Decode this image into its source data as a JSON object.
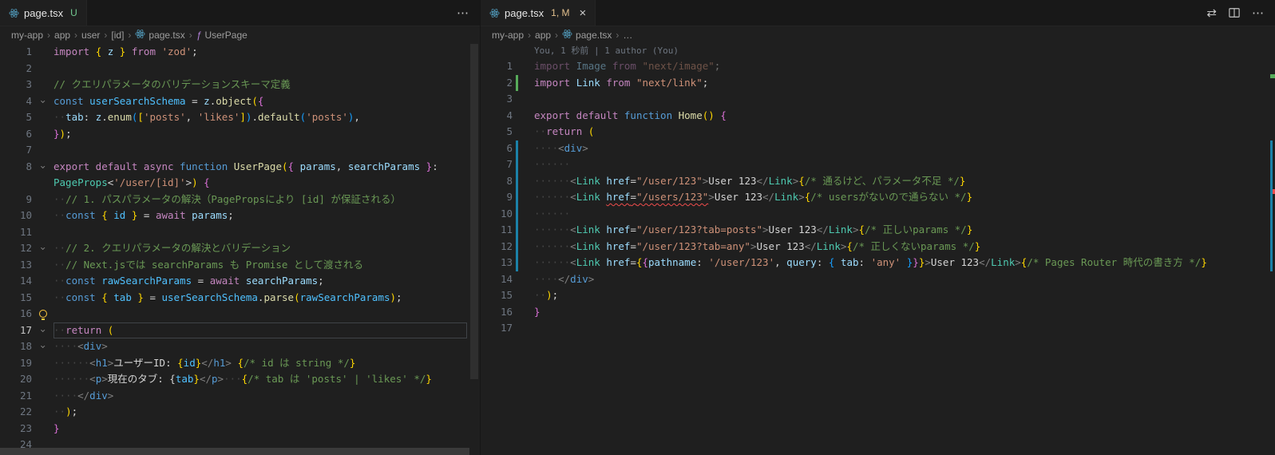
{
  "colors": {
    "editor_bg": "#1f1f1f",
    "tabbar_bg": "#181818",
    "untracked_badge": "#73C991",
    "modified_badge": "#E2C08D",
    "git_added": "#57ab5a",
    "git_modified": "#1B81A8",
    "error": "#F14C4C"
  },
  "left_pane": {
    "tab": {
      "icon": "react",
      "label": "page.tsx",
      "badge": "U"
    },
    "actions": {
      "more": "⋯"
    },
    "breadcrumbs": [
      {
        "label": "my-app"
      },
      {
        "label": "app"
      },
      {
        "label": "user"
      },
      {
        "label": "[id]"
      },
      {
        "label": "page.tsx",
        "icon": "react"
      },
      {
        "label": "UserPage",
        "icon": "symbol-function"
      }
    ],
    "rows": [
      {
        "n": 1,
        "t": [
          [
            "kw",
            "import "
          ],
          [
            "b1",
            "{ "
          ],
          [
            "var",
            "z"
          ],
          [
            "b1",
            " }"
          ],
          [
            "kw",
            " from "
          ],
          [
            "str",
            "'zod'"
          ],
          [
            "pn",
            ";"
          ]
        ]
      },
      {
        "n": 2
      },
      {
        "n": 3,
        "t": [
          [
            "cm",
            "// クエリパラメータのバリデーションスキーマ定義"
          ]
        ]
      },
      {
        "n": 4,
        "fold": true,
        "t": [
          [
            "kw2",
            "const "
          ],
          [
            "cvar",
            "userSearchSchema"
          ],
          [
            "pn",
            " = "
          ],
          [
            "var",
            "z"
          ],
          [
            "pn",
            "."
          ],
          [
            "fn",
            "object"
          ],
          [
            "b1",
            "("
          ],
          [
            "b2",
            "{"
          ]
        ]
      },
      {
        "n": 5,
        "t": [
          [
            "ws",
            "··"
          ],
          [
            "attr",
            "tab"
          ],
          [
            "pn",
            ": "
          ],
          [
            "var",
            "z"
          ],
          [
            "pn",
            "."
          ],
          [
            "fn",
            "enum"
          ],
          [
            "b3",
            "("
          ],
          [
            "b1",
            "["
          ],
          [
            "str",
            "'posts'"
          ],
          [
            "pn",
            ", "
          ],
          [
            "str",
            "'likes'"
          ],
          [
            "b1",
            "]"
          ],
          [
            "b3",
            ")"
          ],
          [
            "pn",
            "."
          ],
          [
            "fn",
            "default"
          ],
          [
            "b3",
            "("
          ],
          [
            "str",
            "'posts'"
          ],
          [
            "b3",
            ")"
          ],
          [
            "pn",
            ","
          ]
        ]
      },
      {
        "n": 6,
        "t": [
          [
            "b2",
            "}"
          ],
          [
            "b1",
            ")"
          ],
          [
            "pn",
            ";"
          ]
        ]
      },
      {
        "n": 7
      },
      {
        "n": 8,
        "fold": true,
        "t": [
          [
            "kw",
            "export default async "
          ],
          [
            "kw2",
            "function "
          ],
          [
            "fn",
            "UserPage"
          ],
          [
            "b1",
            "("
          ],
          [
            "b2",
            "{ "
          ],
          [
            "var",
            "params"
          ],
          [
            "pn",
            ", "
          ],
          [
            "var",
            "searchParams"
          ],
          [
            "b2",
            " }"
          ],
          [
            "pn",
            ":"
          ]
        ]
      },
      {
        "n": null,
        "t": [
          [
            "type",
            "PageProps"
          ],
          [
            "pn",
            "<"
          ],
          [
            "str",
            "'/user/[id]'"
          ],
          [
            "pn",
            ">"
          ],
          [
            "b1",
            ")"
          ],
          [
            "b2",
            " {"
          ]
        ]
      },
      {
        "n": 9,
        "t": [
          [
            "ws",
            "··"
          ],
          [
            "cm",
            "// 1. パスパラメータの解決（PagePropsにより [id] が保証される）"
          ]
        ]
      },
      {
        "n": 10,
        "t": [
          [
            "ws",
            "··"
          ],
          [
            "kw2",
            "const "
          ],
          [
            "b1",
            "{ "
          ],
          [
            "cvar",
            "id"
          ],
          [
            "b1",
            " }"
          ],
          [
            "pn",
            " = "
          ],
          [
            "kw",
            "await "
          ],
          [
            "var",
            "params"
          ],
          [
            "pn",
            ";"
          ]
        ]
      },
      {
        "n": 11
      },
      {
        "n": 12,
        "fold": true,
        "t": [
          [
            "ws",
            "··"
          ],
          [
            "cm",
            "// 2. クエリパラメータの解決とバリデーション"
          ]
        ]
      },
      {
        "n": 13,
        "t": [
          [
            "ws",
            "··"
          ],
          [
            "cm",
            "// Next.jsでは searchParams も Promise として渡される"
          ]
        ]
      },
      {
        "n": 14,
        "t": [
          [
            "ws",
            "··"
          ],
          [
            "kw2",
            "const "
          ],
          [
            "cvar",
            "rawSearchParams"
          ],
          [
            "pn",
            " = "
          ],
          [
            "kw",
            "await "
          ],
          [
            "var",
            "searchParams"
          ],
          [
            "pn",
            ";"
          ]
        ]
      },
      {
        "n": 15,
        "t": [
          [
            "ws",
            "··"
          ],
          [
            "kw2",
            "const "
          ],
          [
            "b1",
            "{ "
          ],
          [
            "cvar",
            "tab"
          ],
          [
            "b1",
            " }"
          ],
          [
            "pn",
            " = "
          ],
          [
            "cvar",
            "userSearchSchema"
          ],
          [
            "pn",
            "."
          ],
          [
            "fn",
            "parse"
          ],
          [
            "b1",
            "("
          ],
          [
            "cvar",
            "rawSearchParams"
          ],
          [
            "b1",
            ")"
          ],
          [
            "pn",
            ";"
          ]
        ]
      },
      {
        "n": 16,
        "bulb": true
      },
      {
        "n": 17,
        "fold": true,
        "current": true,
        "t": [
          [
            "ws",
            "··"
          ],
          [
            "kw",
            "return "
          ],
          [
            "b1",
            "("
          ]
        ]
      },
      {
        "n": 18,
        "fold": true,
        "t": [
          [
            "ws",
            "····"
          ],
          [
            "tagb",
            "<"
          ],
          [
            "tag",
            "div"
          ],
          [
            "tagb",
            ">"
          ]
        ]
      },
      {
        "n": 19,
        "t": [
          [
            "ws",
            "······"
          ],
          [
            "tagb",
            "<"
          ],
          [
            "tag",
            "h1"
          ],
          [
            "tagb",
            ">"
          ],
          [
            "txt",
            "ユーザーID: "
          ],
          [
            "b1",
            "{"
          ],
          [
            "cvar",
            "id"
          ],
          [
            "b1",
            "}"
          ],
          [
            "tagb",
            "</"
          ],
          [
            "tag",
            "h1"
          ],
          [
            "tagb",
            ">"
          ],
          [
            "txt",
            " "
          ],
          [
            "b1",
            "{"
          ],
          [
            "cm",
            "/* id は string */"
          ],
          [
            "b1",
            "}"
          ]
        ]
      },
      {
        "n": 20,
        "t": [
          [
            "ws",
            "······"
          ],
          [
            "tagb",
            "<"
          ],
          [
            "tag",
            "p"
          ],
          [
            "tagb",
            ">"
          ],
          [
            "txt",
            "現在のタブ: {"
          ],
          [
            "cvar",
            "tab"
          ],
          [
            "b1",
            "}"
          ],
          [
            "tagb",
            "</"
          ],
          [
            "tag",
            "p"
          ],
          [
            "tagb",
            ">"
          ],
          [
            "ws",
            "···"
          ],
          [
            "b1",
            "{"
          ],
          [
            "cm",
            "/* tab は 'posts' | 'likes' */"
          ],
          [
            "b1",
            "}"
          ]
        ]
      },
      {
        "n": 21,
        "t": [
          [
            "ws",
            "····"
          ],
          [
            "tagb",
            "</"
          ],
          [
            "tag",
            "div"
          ],
          [
            "tagb",
            ">"
          ]
        ]
      },
      {
        "n": 22,
        "t": [
          [
            "ws",
            "··"
          ],
          [
            "b1",
            ")"
          ],
          [
            "pn",
            ";"
          ]
        ]
      },
      {
        "n": 23,
        "t": [
          [
            "b2",
            "}"
          ]
        ]
      },
      {
        "n": 24
      }
    ]
  },
  "right_pane": {
    "tab": {
      "icon": "react",
      "label": "page.tsx",
      "badge": "1, M",
      "close": "×"
    },
    "actions": {
      "open_changes": "⇄",
      "more": "⋯"
    },
    "lens": "You, 1 秒前 | 1 author (You)",
    "breadcrumbs": [
      {
        "label": "my-app"
      },
      {
        "label": "app"
      },
      {
        "label": "page.tsx",
        "icon": "react"
      },
      {
        "label": "…"
      }
    ],
    "rows": [
      {
        "n": 1,
        "dim": true,
        "t": [
          [
            "kw",
            "import "
          ],
          [
            "var",
            "Image"
          ],
          [
            "kw",
            " from "
          ],
          [
            "str",
            "\"next/image\""
          ],
          [
            "pn",
            ";"
          ]
        ]
      },
      {
        "n": 2,
        "git": "added",
        "t": [
          [
            "kw",
            "import "
          ],
          [
            "var",
            "Link"
          ],
          [
            "kw",
            " from "
          ],
          [
            "str",
            "\"next/link\""
          ],
          [
            "pn",
            ";"
          ]
        ]
      },
      {
        "n": 3
      },
      {
        "n": 4,
        "t": [
          [
            "kw",
            "export default "
          ],
          [
            "kw2",
            "function "
          ],
          [
            "fn",
            "Home"
          ],
          [
            "b1",
            "() "
          ],
          [
            "b2",
            "{"
          ]
        ]
      },
      {
        "n": 5,
        "t": [
          [
            "ws",
            "··"
          ],
          [
            "kw",
            "return "
          ],
          [
            "b1",
            "("
          ]
        ]
      },
      {
        "n": 6,
        "git": "modified",
        "t": [
          [
            "ws",
            "····"
          ],
          [
            "tagb",
            "<"
          ],
          [
            "tag",
            "div"
          ],
          [
            "tagb",
            ">"
          ]
        ]
      },
      {
        "n": 7,
        "git": "modified",
        "t": [
          [
            "ws",
            "······"
          ]
        ]
      },
      {
        "n": 8,
        "git": "modified",
        "t": [
          [
            "ws",
            "······"
          ],
          [
            "tagb",
            "<"
          ],
          [
            "type",
            "Link"
          ],
          [
            "pn",
            " "
          ],
          [
            "attr",
            "href"
          ],
          [
            "pn",
            "="
          ],
          [
            "str",
            "\"/user/123\""
          ],
          [
            "tagb",
            ">"
          ],
          [
            "txt",
            "User 123"
          ],
          [
            "tagb",
            "</"
          ],
          [
            "type",
            "Link"
          ],
          [
            "tagb",
            ">"
          ],
          [
            "b1",
            "{"
          ],
          [
            "cm",
            "/* 通るけど、パラメータ不足 */"
          ],
          [
            "b1",
            "}"
          ]
        ]
      },
      {
        "n": 9,
        "git": "modified",
        "t": [
          [
            "ws",
            "······"
          ],
          [
            "tagb",
            "<"
          ],
          [
            "type",
            "Link"
          ],
          [
            "pn",
            " "
          ],
          [
            "attr err",
            "href"
          ],
          [
            "pn err",
            "="
          ],
          [
            "str err",
            "\"/users/123\""
          ],
          [
            "tagb",
            ">"
          ],
          [
            "txt",
            "User 123"
          ],
          [
            "tagb",
            "</"
          ],
          [
            "type",
            "Link"
          ],
          [
            "tagb",
            ">"
          ],
          [
            "b1",
            "{"
          ],
          [
            "cm",
            "/* usersがないので通らない */"
          ],
          [
            "b1",
            "}"
          ]
        ]
      },
      {
        "n": 10,
        "git": "modified",
        "t": [
          [
            "ws",
            "······"
          ]
        ]
      },
      {
        "n": 11,
        "git": "modified",
        "t": [
          [
            "ws",
            "······"
          ],
          [
            "tagb",
            "<"
          ],
          [
            "type",
            "Link"
          ],
          [
            "pn",
            " "
          ],
          [
            "attr",
            "href"
          ],
          [
            "pn",
            "="
          ],
          [
            "str",
            "\"/user/123?tab=posts\""
          ],
          [
            "tagb",
            ">"
          ],
          [
            "txt",
            "User 123"
          ],
          [
            "tagb",
            "</"
          ],
          [
            "type",
            "Link"
          ],
          [
            "tagb",
            ">"
          ],
          [
            "b1",
            "{"
          ],
          [
            "cm",
            "/* 正しいparams */"
          ],
          [
            "b1",
            "}"
          ]
        ]
      },
      {
        "n": 12,
        "git": "modified",
        "t": [
          [
            "ws",
            "······"
          ],
          [
            "tagb",
            "<"
          ],
          [
            "type",
            "Link"
          ],
          [
            "pn",
            " "
          ],
          [
            "attr",
            "href"
          ],
          [
            "pn",
            "="
          ],
          [
            "str",
            "\"/user/123?tab=any\""
          ],
          [
            "tagb",
            ">"
          ],
          [
            "txt",
            "User 123"
          ],
          [
            "tagb",
            "</"
          ],
          [
            "type",
            "Link"
          ],
          [
            "tagb",
            ">"
          ],
          [
            "b1",
            "{"
          ],
          [
            "cm",
            "/* 正しくないparams */"
          ],
          [
            "b1",
            "}"
          ]
        ]
      },
      {
        "n": 13,
        "git": "modified",
        "t": [
          [
            "ws",
            "······"
          ],
          [
            "tagb",
            "<"
          ],
          [
            "type",
            "Link"
          ],
          [
            "pn",
            " "
          ],
          [
            "attr",
            "href"
          ],
          [
            "pn",
            "="
          ],
          [
            "b1",
            "{"
          ],
          [
            "b2",
            "{"
          ],
          [
            "var",
            "pathname"
          ],
          [
            "pn",
            ": "
          ],
          [
            "str",
            "'/user/123'"
          ],
          [
            "pn",
            ", "
          ],
          [
            "var",
            "query"
          ],
          [
            "pn",
            ": "
          ],
          [
            "b3",
            "{ "
          ],
          [
            "var",
            "tab"
          ],
          [
            "pn",
            ": "
          ],
          [
            "str",
            "'any'"
          ],
          [
            "b3",
            " }"
          ],
          [
            "b2",
            "}"
          ],
          [
            "b1",
            "}"
          ],
          [
            "tagb",
            ">"
          ],
          [
            "txt",
            "User 123"
          ],
          [
            "tagb",
            "</"
          ],
          [
            "type",
            "Link"
          ],
          [
            "tagb",
            ">"
          ],
          [
            "b1",
            "{"
          ],
          [
            "cm",
            "/* Pages Router 時代の書き方 */"
          ],
          [
            "b1",
            "}"
          ]
        ]
      },
      {
        "n": 14,
        "t": [
          [
            "ws",
            "····"
          ],
          [
            "tagb",
            "</"
          ],
          [
            "tag",
            "div"
          ],
          [
            "tagb",
            ">"
          ]
        ]
      },
      {
        "n": 15,
        "t": [
          [
            "ws",
            "··"
          ],
          [
            "b1",
            ")"
          ],
          [
            "pn",
            ";"
          ]
        ]
      },
      {
        "n": 16,
        "t": [
          [
            "b2",
            "}"
          ]
        ]
      },
      {
        "n": 17
      }
    ]
  }
}
